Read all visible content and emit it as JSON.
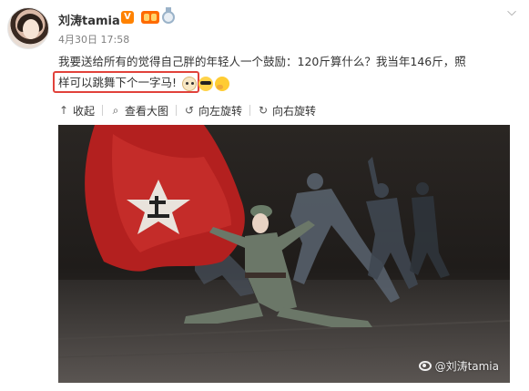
{
  "user": {
    "name": "刘涛tamia",
    "verified_badge": "V",
    "vip_icon": "vip-icon",
    "medal_icon": "medal-icon"
  },
  "menu": {
    "dropdown_icon": "chevron-down-icon",
    "glyph": "⌵"
  },
  "post": {
    "timestamp": "4月30日 17:58",
    "text_line1": "我要送给所有的觉得自己胖的年轻人一个鼓励：120斤算什么？我当年146斤，照",
    "text_line2": "样可以跳舞下个一字马!",
    "emojis": [
      "dog-emoji",
      "cool-emoji",
      "thinking-emoji"
    ],
    "highlight_color": "#e1423b"
  },
  "toolbar": {
    "collapse_label": "收起",
    "collapse_glyph": "↑",
    "view_large_label": "查看大图",
    "view_large_glyph": "⌕",
    "rotate_left_label": "向左旋转",
    "rotate_left_glyph": "↺",
    "rotate_right_label": "向右旋转",
    "rotate_right_glyph": "↻"
  },
  "photo": {
    "watermark": "@刘涛tamia",
    "watermark_icon": "weibo-icon"
  }
}
